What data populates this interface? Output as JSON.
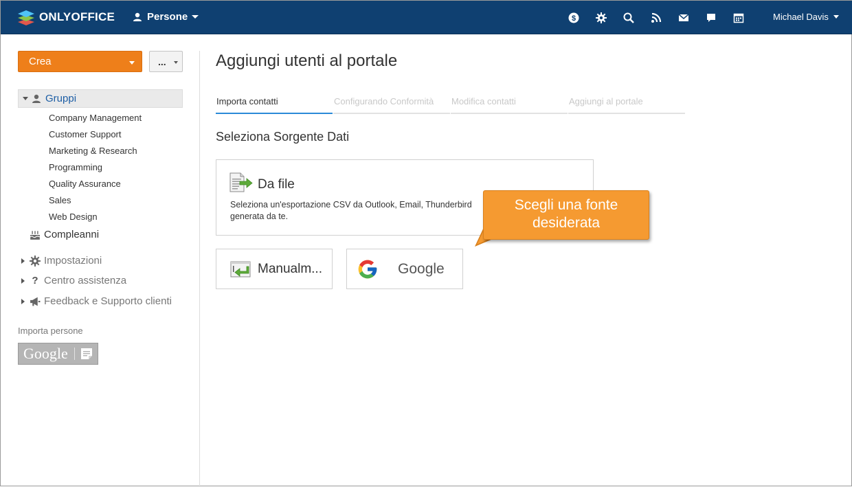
{
  "header": {
    "logo_text": "ONLYOFFICE",
    "module_label": "Persone",
    "icons": [
      "money-circle-icon",
      "gear-icon",
      "search-icon",
      "feed-icon",
      "mail-icon",
      "chat-icon",
      "calendar-icon"
    ],
    "user_name": "Michael Davis"
  },
  "sidebar": {
    "create_label": "Crea",
    "more_label": "...",
    "groups_label": "Gruppi",
    "groups": [
      "Company Management",
      "Customer Support",
      "Marketing & Research",
      "Programming",
      "Quality Assurance",
      "Sales",
      "Web Design"
    ],
    "birthdays_label": "Compleanni",
    "settings_label": "Impostazioni",
    "help_label": "Centro assistenza",
    "feedback_label": "Feedback e Supporto clienti",
    "import_label": "Importa persone",
    "import_badge_text": "Google"
  },
  "main": {
    "title": "Aggiungi utenti al portale",
    "steps": [
      "Importa contatti",
      "Configurando Conformità",
      "Modifica contatti",
      "Aggiungi al portale"
    ],
    "active_step": 0,
    "section_title": "Seleziona Sorgente Dati",
    "file_card": {
      "title": "Da file",
      "description": "Seleziona un'esportazione CSV da Outlook, Email, Thunderbird generata da te."
    },
    "manual_card_title": "Manualm...",
    "google_card_title": "Google"
  },
  "callout": {
    "line1": "Scegli una fonte",
    "line2": "desiderata"
  },
  "colors": {
    "topbar": "#0f4071",
    "accent_orange": "#ee7f1a",
    "callout": "#f59a31",
    "link_blue": "#1d5ea5",
    "active_step": "#2b8ad8"
  }
}
